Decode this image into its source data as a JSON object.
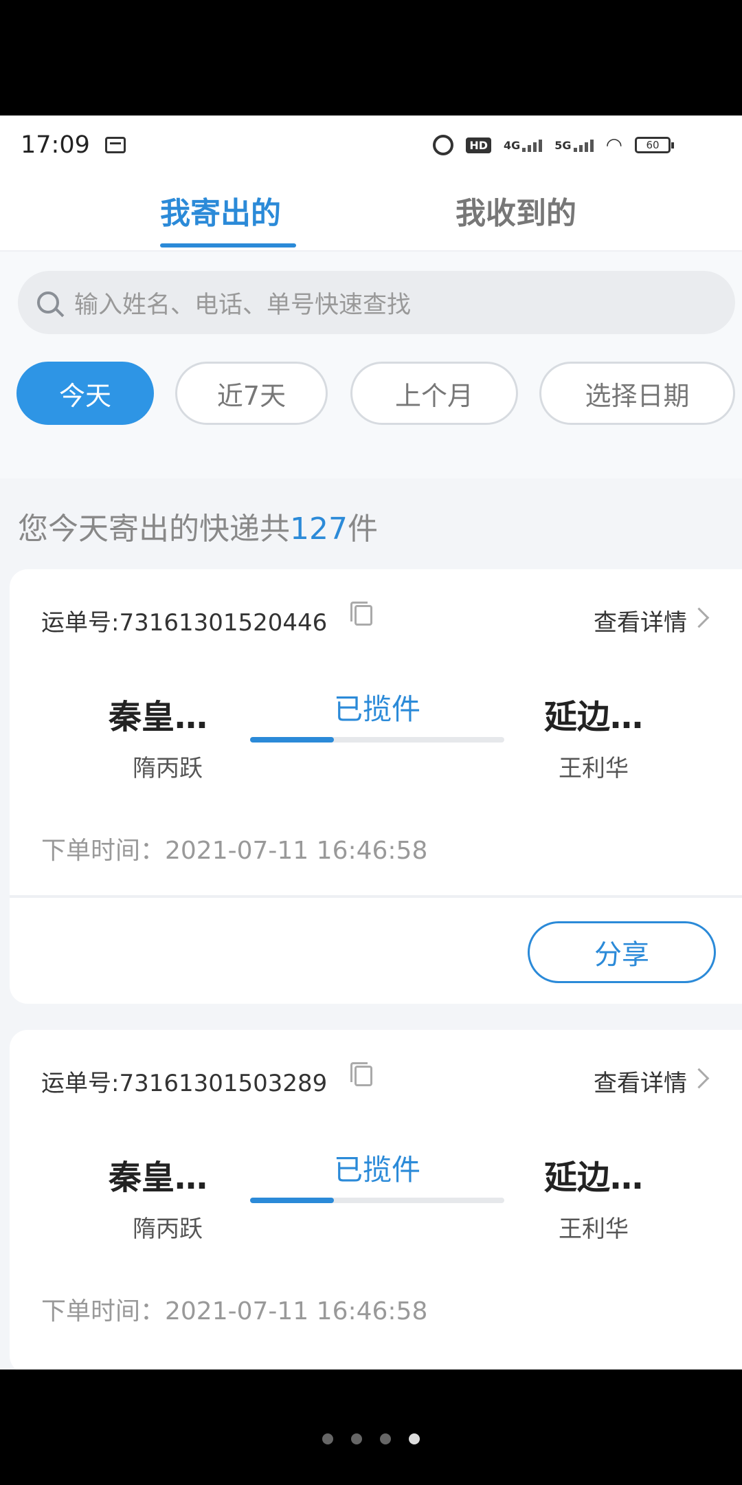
{
  "status_bar": {
    "time": "17:09",
    "hd_label": "HD",
    "signal1_label": "4G",
    "signal2_label": "5G",
    "battery": "60"
  },
  "tabs": [
    {
      "label": "我寄出的",
      "active": true
    },
    {
      "label": "我收到的",
      "active": false
    }
  ],
  "search": {
    "placeholder": "输入姓名、电话、单号快速查找"
  },
  "filters": [
    {
      "label": "今天",
      "active": true
    },
    {
      "label": "近7天",
      "active": false
    },
    {
      "label": "上个月",
      "active": false
    },
    {
      "label": "选择日期",
      "active": false
    }
  ],
  "summary": {
    "prefix": "您今天寄出的快递共",
    "count": "127",
    "suffix": "件"
  },
  "orders": [
    {
      "waybill": "运单号:73161301520446",
      "detail_label": "查看详情",
      "from_city": "秦皇…",
      "from_person": "隋丙跃",
      "status": "已揽件",
      "progress": 0.33,
      "to_city": "延边…",
      "to_person": "王利华",
      "order_time": "下单时间：2021-07-11 16:46:58",
      "share_label": "分享"
    },
    {
      "waybill": "运单号:73161301503289",
      "detail_label": "查看详情",
      "from_city": "秦皇…",
      "from_person": "隋丙跃",
      "status": "已揽件",
      "progress": 0.33,
      "to_city": "延边…",
      "to_person": "王利华",
      "order_time": "下单时间：2021-07-11 16:46:58"
    }
  ],
  "colors": {
    "accent": "#2b8ad8",
    "chip_active": "#2e95e5"
  }
}
